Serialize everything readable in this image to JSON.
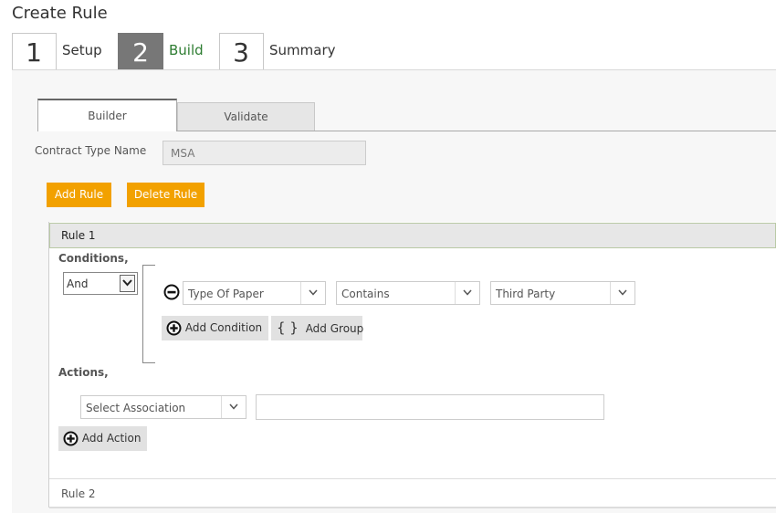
{
  "page": {
    "title": "Create Rule"
  },
  "wizard": {
    "steps": [
      {
        "number": "1",
        "label": "Setup",
        "active": false
      },
      {
        "number": "2",
        "label": "Build",
        "active": true
      },
      {
        "number": "3",
        "label": "Summary",
        "active": false
      }
    ]
  },
  "tabs": {
    "builder": "Builder",
    "validate": "Validate"
  },
  "form": {
    "contract_type_label": "Contract Type Name",
    "contract_type_value": "MSA"
  },
  "toolbar": {
    "add_rule": "Add Rule",
    "delete_rule": "Delete Rule"
  },
  "rules": {
    "rule1": {
      "title": "Rule 1",
      "conditions_label": "Conditions,",
      "logic_operator": "And",
      "condition": {
        "field": "Type Of Paper",
        "operator": "Contains",
        "value": "Third Party"
      },
      "add_condition": "Add Condition",
      "add_group": "Add Group",
      "group_glyph": "{ }",
      "actions_label": "Actions,",
      "association_placeholder": "Select Association",
      "action_value": "",
      "add_action": "Add Action"
    },
    "rule2": {
      "title": "Rule 2"
    }
  },
  "icons": {
    "remove_condition": "minus-circle-icon",
    "add": "plus-circle-icon",
    "dropdown": "chevron-down-icon"
  },
  "colors": {
    "accent_orange": "#f2a100",
    "active_step": "#777777",
    "active_label": "#2e7d32"
  }
}
